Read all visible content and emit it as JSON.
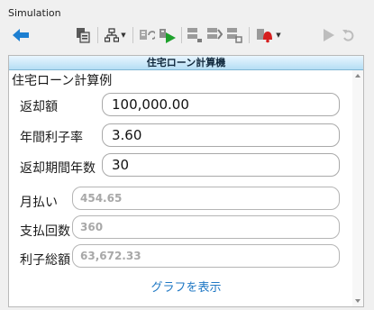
{
  "panel": {
    "title": "Simulation"
  },
  "toolbar": {
    "icons": [
      "back-arrow-icon",
      "clipboard-copy-icon",
      "hierarchy-icon",
      "reload-icon",
      "run-icon",
      "step-icon",
      "step-over-icon",
      "step-out-icon",
      "alert-bell-icon",
      "play-icon",
      "undo-icon"
    ]
  },
  "form": {
    "header": "住宅ローン計算機",
    "subtitle": "住宅ローン計算例",
    "fields": [
      {
        "label": "返却額",
        "value": "100,000.00",
        "readonly": false
      },
      {
        "label": "年間利子率",
        "value": "3.60",
        "readonly": false
      },
      {
        "label": "返却期間年数",
        "value": "30",
        "readonly": false
      },
      {
        "label": "月払い",
        "value": "454.65",
        "readonly": true
      },
      {
        "label": "支払回数",
        "value": "360",
        "readonly": true
      },
      {
        "label": "利子総額",
        "value": "63,672.33",
        "readonly": true
      }
    ],
    "link": "グラフを表示"
  },
  "colors": {
    "accent": "#1f78c4",
    "header_bg": "#b5def4"
  }
}
